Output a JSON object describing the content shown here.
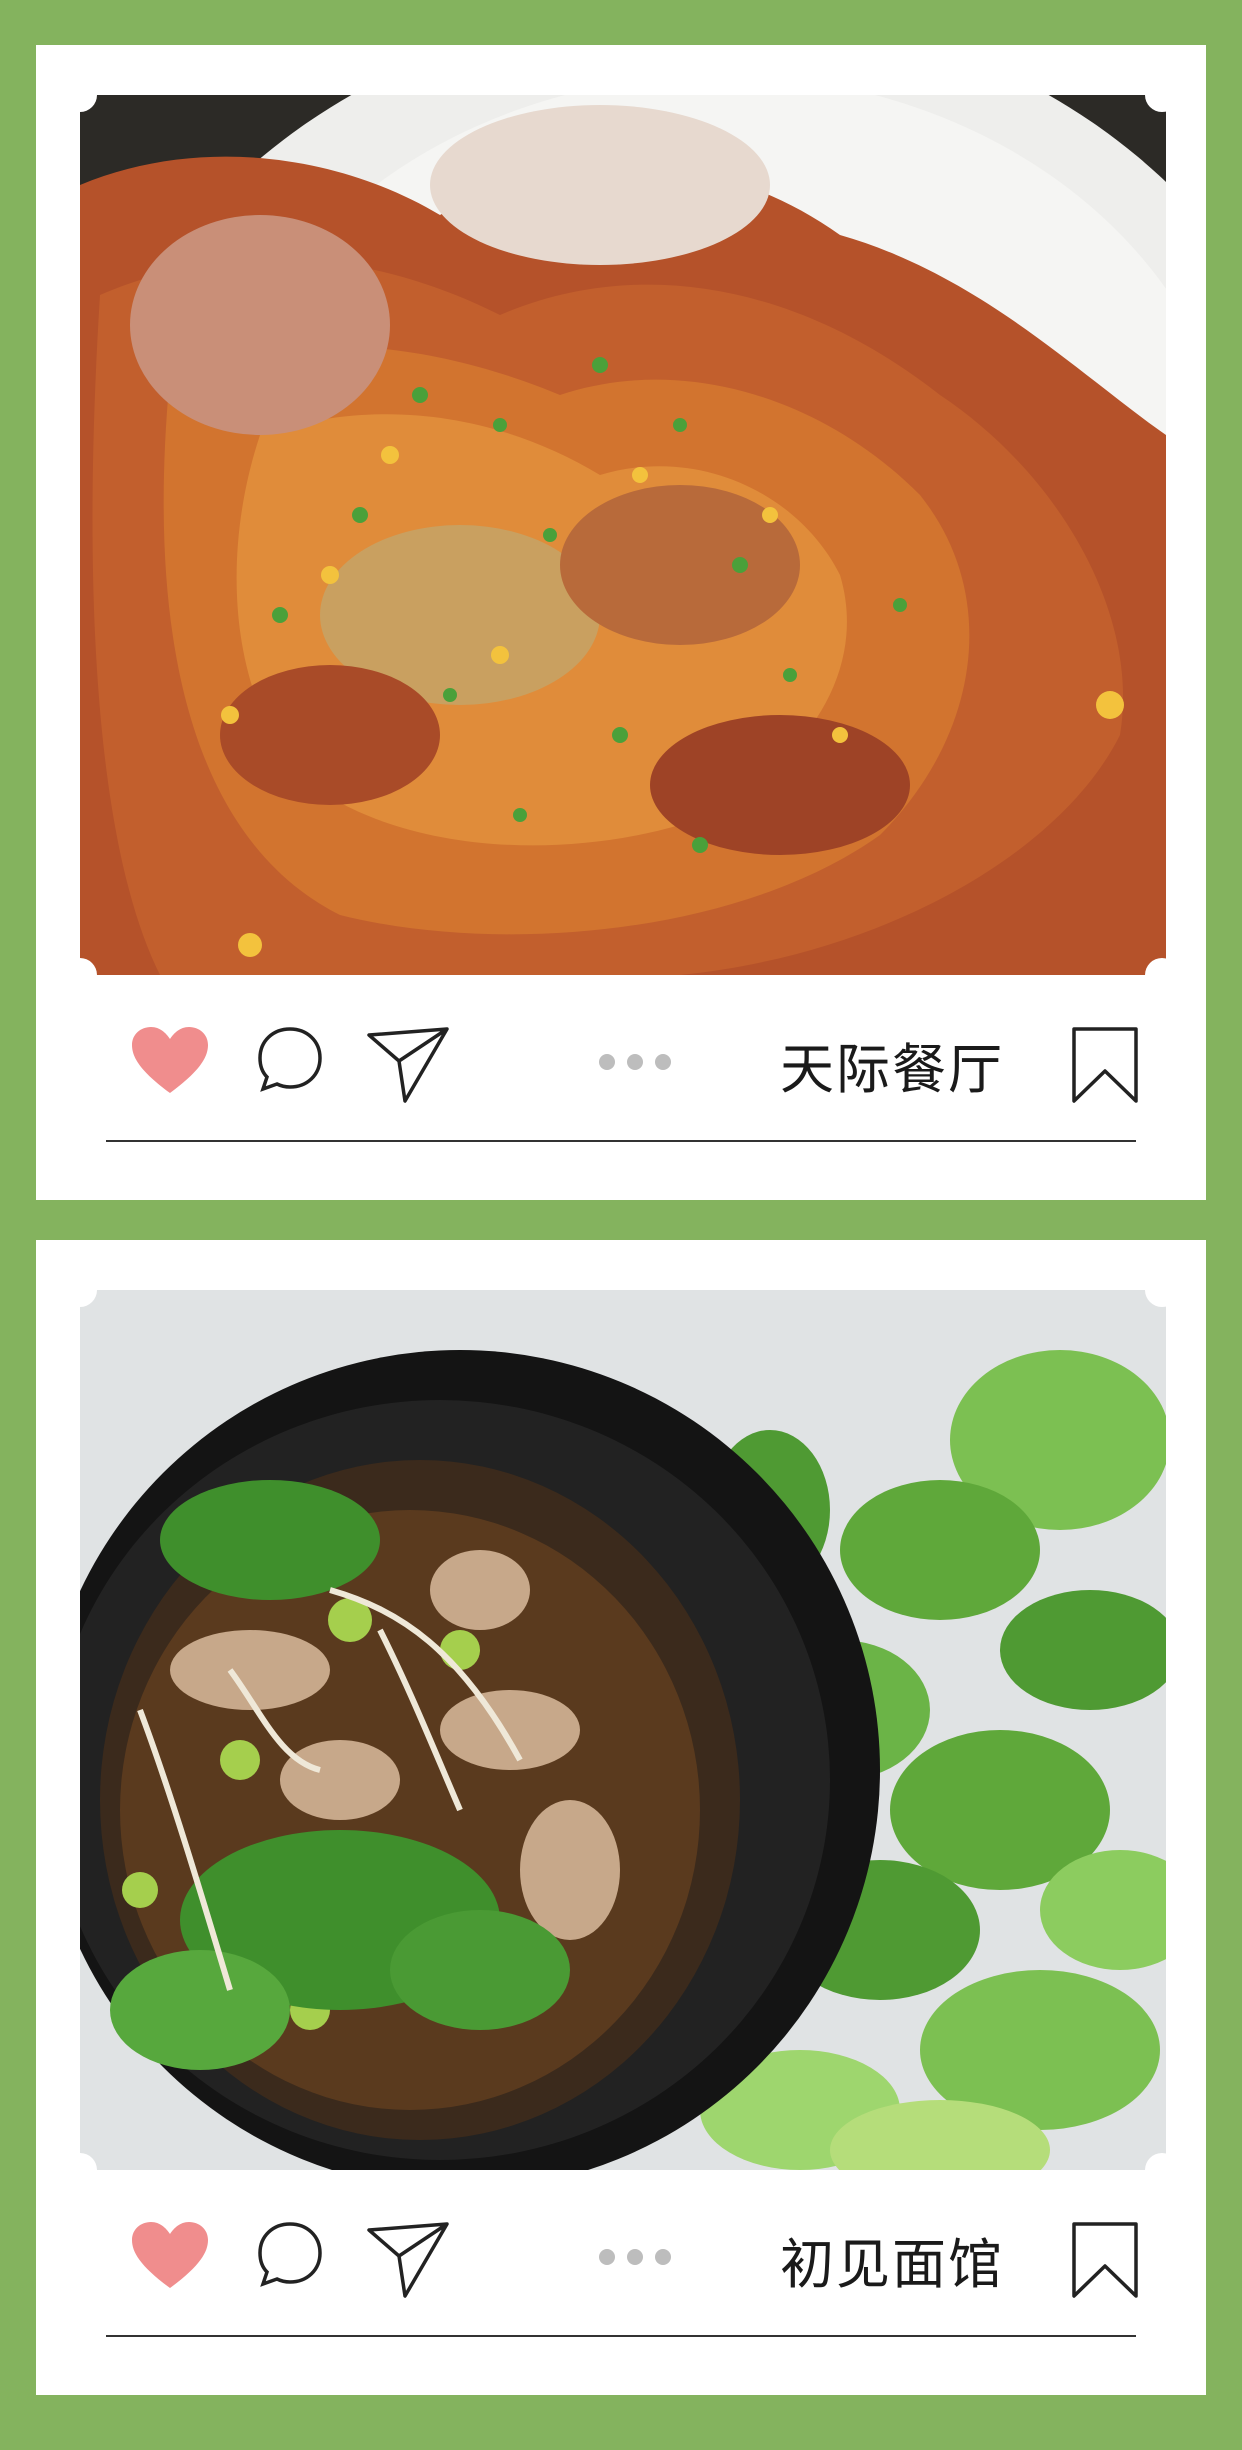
{
  "cards": [
    {
      "title": "天际餐厅",
      "photo_icon": "spicy-fried-meat-photo",
      "accent_like": "#f08d8d"
    },
    {
      "title": "初见面馆",
      "photo_icon": "mushroom-noodle-soup-photo",
      "accent_like": "#f08d8d"
    }
  ],
  "colors": {
    "background": "#84b35e",
    "card": "#ffffff",
    "heart": "#f08d8d",
    "dots": "#bdbdbd",
    "stroke": "#222222"
  }
}
